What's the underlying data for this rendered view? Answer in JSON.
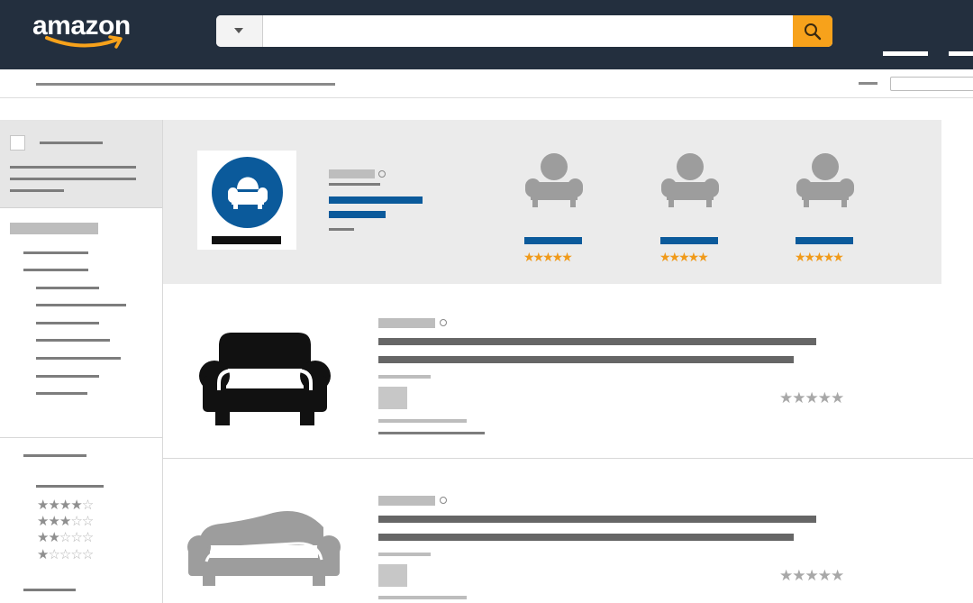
{
  "header": {
    "logo_text": "amazon",
    "search_placeholder": "",
    "accent_color": "#f7a21b",
    "background_color": "#232f3e"
  },
  "icons": {
    "search": "search-icon",
    "dropdown": "chevron-down-icon",
    "chair": "armchair-icon",
    "sofa": "sofa-icon",
    "chaise": "chaise-lounge-icon",
    "info": "info-icon",
    "star": "star-icon"
  },
  "sidebar": {
    "rating_filters": [
      {
        "full": "★★★★",
        "empty": "☆"
      },
      {
        "full": "★★★",
        "empty": "☆☆"
      },
      {
        "full": "★★",
        "empty": "☆☆☆"
      },
      {
        "full": "★",
        "empty": "☆☆☆☆"
      }
    ]
  },
  "sponsored": {
    "brand_color": "#0b5a9b",
    "products": [
      {
        "stars": "★★★★★",
        "rating": 5
      },
      {
        "stars": "★★★★★",
        "rating": 5
      },
      {
        "stars": "★★★★★",
        "rating": 5
      }
    ]
  },
  "results": [
    {
      "stars": "★★★★★",
      "rating": 5
    },
    {
      "stars": "★★★★★",
      "rating": 5
    }
  ]
}
